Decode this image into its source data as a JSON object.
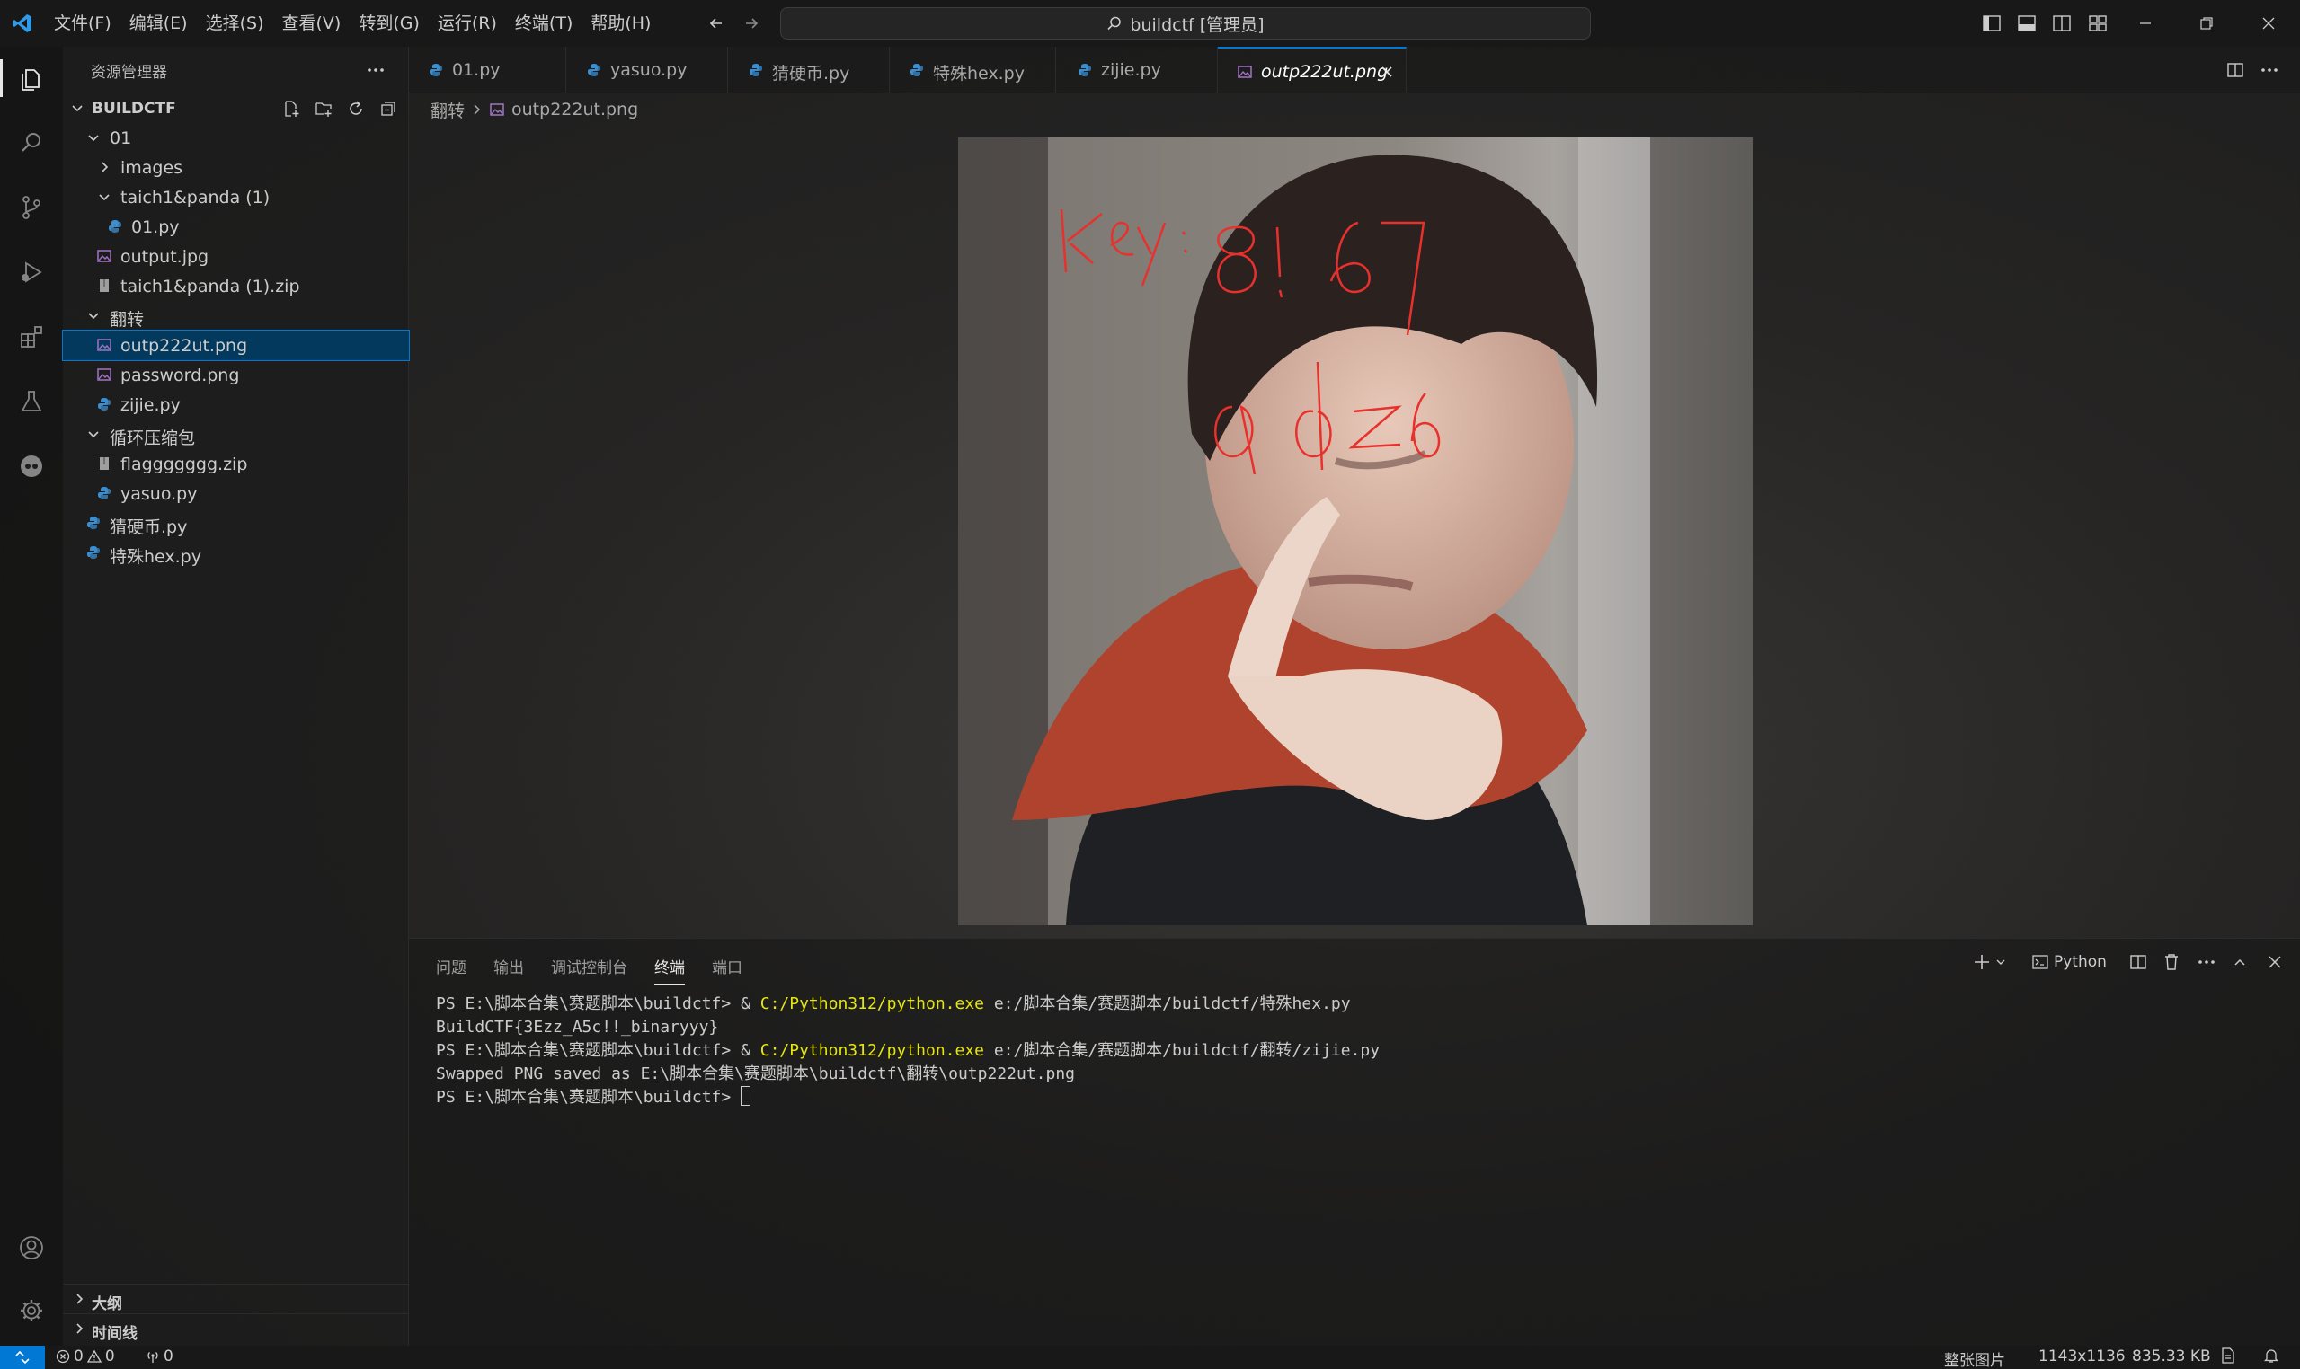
{
  "menu": [
    "文件(F)",
    "编辑(E)",
    "选择(S)",
    "查看(V)",
    "转到(G)",
    "运行(R)",
    "终端(T)",
    "帮助(H)"
  ],
  "command_center": {
    "text": "buildctf [管理员]",
    "icon": "search-icon"
  },
  "activity_bar": [
    "files-icon",
    "search-icon",
    "source-control-icon",
    "run-debug-icon",
    "extensions-icon",
    "testing-icon",
    "copilot-icon",
    "account-icon",
    "settings-gear-icon"
  ],
  "explorer": {
    "title": "资源管理器",
    "root": "BUILDCTF",
    "tree": [
      {
        "label": "01",
        "type": "folder",
        "open": true
      },
      {
        "label": "images",
        "type": "folder",
        "open": false
      },
      {
        "label": "taich1&panda (1)",
        "type": "folder",
        "open": true
      },
      {
        "label": "01.py",
        "type": "py"
      },
      {
        "label": "output.jpg",
        "type": "img"
      },
      {
        "label": "taich1&panda (1).zip",
        "type": "zip"
      },
      {
        "label": "翻转",
        "type": "folder",
        "open": true
      },
      {
        "label": "outp222ut.png",
        "type": "img",
        "selected": true
      },
      {
        "label": "password.png",
        "type": "img"
      },
      {
        "label": "zijie.py",
        "type": "py"
      },
      {
        "label": "循环压缩包",
        "type": "folder",
        "open": true
      },
      {
        "label": "flaggggggg.zip",
        "type": "zip"
      },
      {
        "label": "yasuo.py",
        "type": "py"
      },
      {
        "label": "猜硬币.py",
        "type": "py"
      },
      {
        "label": "特殊hex.py",
        "type": "py"
      }
    ],
    "outline": "大纲",
    "timeline": "时间线"
  },
  "tabs": [
    {
      "label": "01.py",
      "type": "py"
    },
    {
      "label": "yasuo.py",
      "type": "py"
    },
    {
      "label": "猜硬币.py",
      "type": "py"
    },
    {
      "label": "特殊hex.py",
      "type": "py"
    },
    {
      "label": "zijie.py",
      "type": "py"
    },
    {
      "label": "outp222ut.png",
      "type": "img",
      "active": true
    }
  ],
  "breadcrumb": {
    "folder": "翻转",
    "file": "outp222ut.png"
  },
  "image": {
    "annotation_line1": "key: 8!67",
    "annotation_line2": "adz6",
    "annotation_color": "#e8302c"
  },
  "panel": {
    "tabs": [
      "问题",
      "输出",
      "调试控制台",
      "终端",
      "端口"
    ],
    "active_tab": "终端",
    "terminal_profile": "Python",
    "terminal_lines": [
      {
        "prefix": "PS E:\\脚本合集\\赛题脚本\\buildctf> & ",
        "cmd": "C:/Python312/python.exe",
        "rest": " e:/脚本合集/赛题脚本/buildctf/特殊hex.py"
      },
      {
        "prefix": "BuildCTF{3Ezz_A5c!!_binaryyy}",
        "cmd": "",
        "rest": ""
      },
      {
        "prefix": "PS E:\\脚本合集\\赛题脚本\\buildctf> & ",
        "cmd": "C:/Python312/python.exe",
        "rest": " e:/脚本合集/赛题脚本/buildctf/翻转/zijie.py"
      },
      {
        "prefix": "Swapped PNG saved as E:\\脚本合集\\赛题脚本\\buildctf\\翻转\\outp222ut.png",
        "cmd": "",
        "rest": ""
      }
    ],
    "prompt": "PS E:\\脚本合集\\赛题脚本\\buildctf> "
  },
  "status": {
    "errors": "0",
    "warnings": "0",
    "ports": "0",
    "zoom": "整张图片",
    "dimensions": "1143x1136",
    "size": "835.33 KB"
  },
  "colors": {
    "accent": "#0078d4",
    "py_icon": "#3b8ed0",
    "img_icon": "#a074c4",
    "terminal_cmd": "#e5e510"
  }
}
